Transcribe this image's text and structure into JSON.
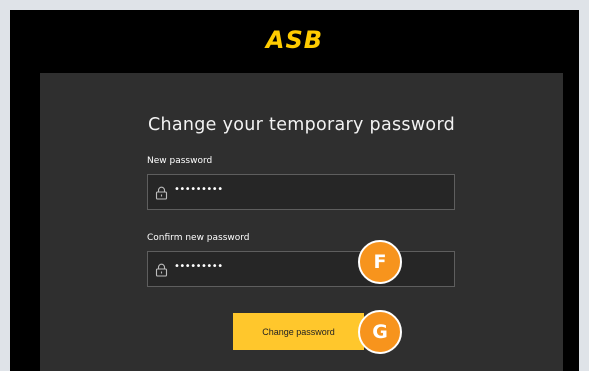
{
  "brand": {
    "logo_text": "ASB"
  },
  "form": {
    "title": "Change your temporary password",
    "new_password": {
      "label": "New password",
      "value": "•••••••••"
    },
    "confirm_password": {
      "label": "Confirm new password",
      "value": "•••••••••"
    },
    "submit_label": "Change password"
  },
  "markers": {
    "f": "F",
    "g": "G"
  },
  "colors": {
    "brand_yellow": "#ffc72c",
    "marker_orange": "#f7941d",
    "card_bg": "#2f2f2f"
  }
}
